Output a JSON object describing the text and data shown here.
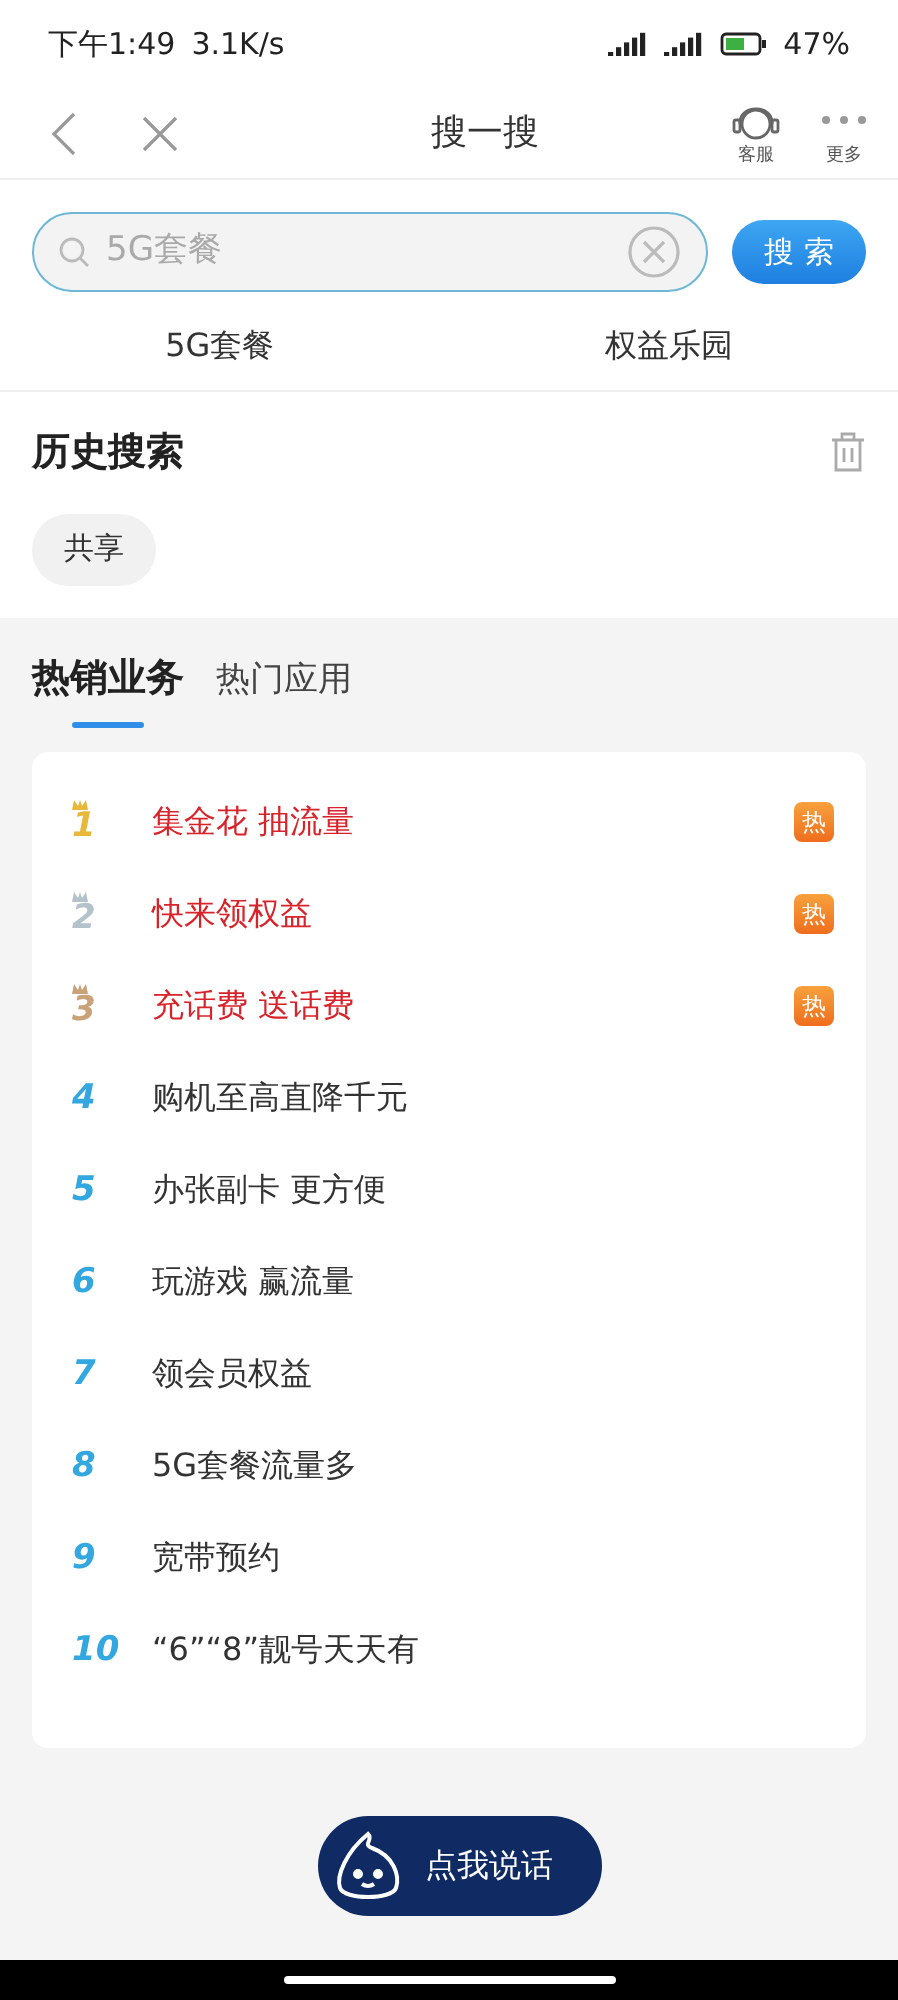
{
  "status_bar": {
    "time": "下午1:49",
    "speed": "3.1K/s",
    "battery": "47%"
  },
  "header": {
    "title": "搜一搜",
    "actions": [
      {
        "label": "客服",
        "kind": "service"
      },
      {
        "label": "更多",
        "kind": "more"
      }
    ]
  },
  "search": {
    "value": "5G套餐",
    "button": "搜 索"
  },
  "suggestions": [
    "5G套餐",
    "权益乐园"
  ],
  "history": {
    "title": "历史搜索",
    "items": [
      "共享"
    ]
  },
  "tabs": [
    {
      "label": "热销业务",
      "selected": true
    },
    {
      "label": "热门应用",
      "selected": false
    }
  ],
  "ranking": [
    {
      "rank": "1",
      "title": "集金花 抽流量",
      "kind": "medal",
      "color": "#e8b83a",
      "hot": true,
      "badge": "热"
    },
    {
      "rank": "2",
      "title": "快来领权益",
      "kind": "medal",
      "color": "#b4c2cc",
      "hot": true,
      "badge": "热"
    },
    {
      "rank": "3",
      "title": "充话费 送话费",
      "kind": "medal",
      "color": "#c9a27a",
      "hot": true,
      "badge": "热"
    },
    {
      "rank": "4",
      "title": "购机至高直降千元",
      "kind": "plain",
      "hot": false
    },
    {
      "rank": "5",
      "title": "办张副卡 更方便",
      "kind": "plain",
      "hot": false
    },
    {
      "rank": "6",
      "title": "玩游戏 赢流量",
      "kind": "plain",
      "hot": false
    },
    {
      "rank": "7",
      "title": "领会员权益",
      "kind": "plain",
      "hot": false
    },
    {
      "rank": "8",
      "title": "5G套餐流量多",
      "kind": "plain",
      "hot": false
    },
    {
      "rank": "9",
      "title": "宽带预约",
      "kind": "plain",
      "hot": false
    },
    {
      "rank": "10",
      "title": "“6”“8”靓号天天有",
      "kind": "plain",
      "hot": false
    }
  ],
  "voice_button": {
    "label": "点我说话"
  }
}
